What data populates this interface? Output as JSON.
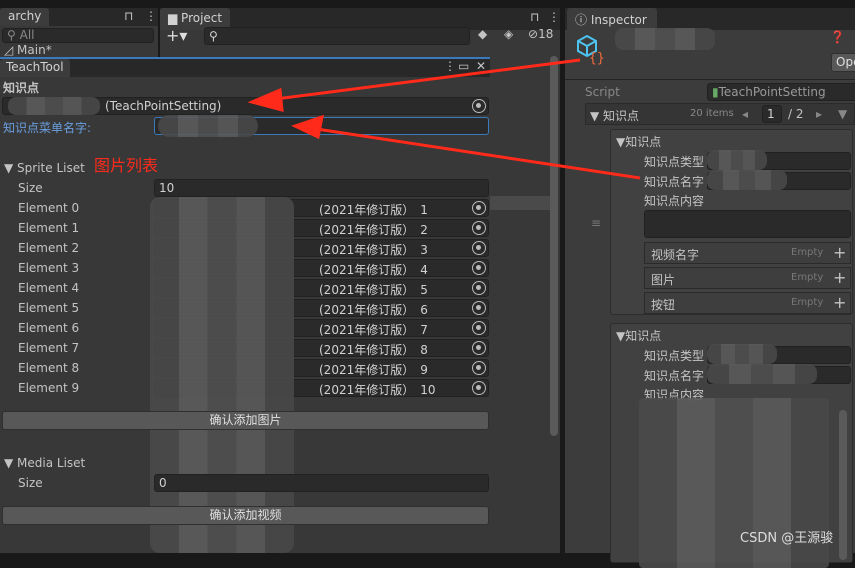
{
  "hierarchy": {
    "tab": "archy",
    "search_placeholder": "All",
    "scene": "Main*"
  },
  "project": {
    "tab": "Project",
    "hidden_count": "18"
  },
  "inspector": {
    "tab": "Inspector",
    "open_button": "Ope",
    "script_label": "Script",
    "script_value": "TeachPointSetting",
    "list_label": "知识点",
    "items_count": "20 items",
    "page": "1",
    "page_total": "/ 2",
    "elements": [
      {
        "header": "知识点",
        "type_label": "知识点类型",
        "name_label": "知识点名字",
        "content_label": "知识点内容",
        "lists": [
          {
            "label": "视频名字",
            "state": "Empty"
          },
          {
            "label": "图片",
            "state": "Empty"
          },
          {
            "label": "按钮",
            "state": "Empty"
          }
        ]
      },
      {
        "header": "知识点",
        "type_label": "知识点类型",
        "name_label": "知识点名字",
        "content_label": "知识点内容"
      }
    ]
  },
  "teachtool": {
    "tab": "TeachTool",
    "section": "知识点",
    "object_suffix": "(TeachPointSetting)",
    "menu_name_label": "知识点菜单名字:",
    "sprite_list": {
      "label": "Sprite Liset",
      "annotation": "图片列表",
      "size_label": "Size",
      "size": "10",
      "elements": [
        {
          "label": "Element 0",
          "value": "(2021年修订版）_1"
        },
        {
          "label": "Element 1",
          "value": "(2021年修订版）_2"
        },
        {
          "label": "Element 2",
          "value": "(2021年修订版）_3"
        },
        {
          "label": "Element 3",
          "value": "(2021年修订版）_4"
        },
        {
          "label": "Element 4",
          "value": "(2021年修订版）_5"
        },
        {
          "label": "Element 5",
          "value": "(2021年修订版）_6"
        },
        {
          "label": "Element 6",
          "value": "(2021年修订版）_7"
        },
        {
          "label": "Element 7",
          "value": "(2021年修订版）_8"
        },
        {
          "label": "Element 8",
          "value": "(2021年修订版）_9"
        },
        {
          "label": "Element 9",
          "value": "(2021年修订版）_10"
        }
      ],
      "add_button": "确认添加图片"
    },
    "media_list": {
      "label": "Media Liset",
      "size_label": "Size",
      "size": "0",
      "add_button": "确认添加视频"
    }
  },
  "watermark": "CSDN @王源骏",
  "colors": {
    "annotation_red": "#ff2a1a",
    "accent_blue": "#3a79bb",
    "label_blue": "#6a9fe0"
  }
}
